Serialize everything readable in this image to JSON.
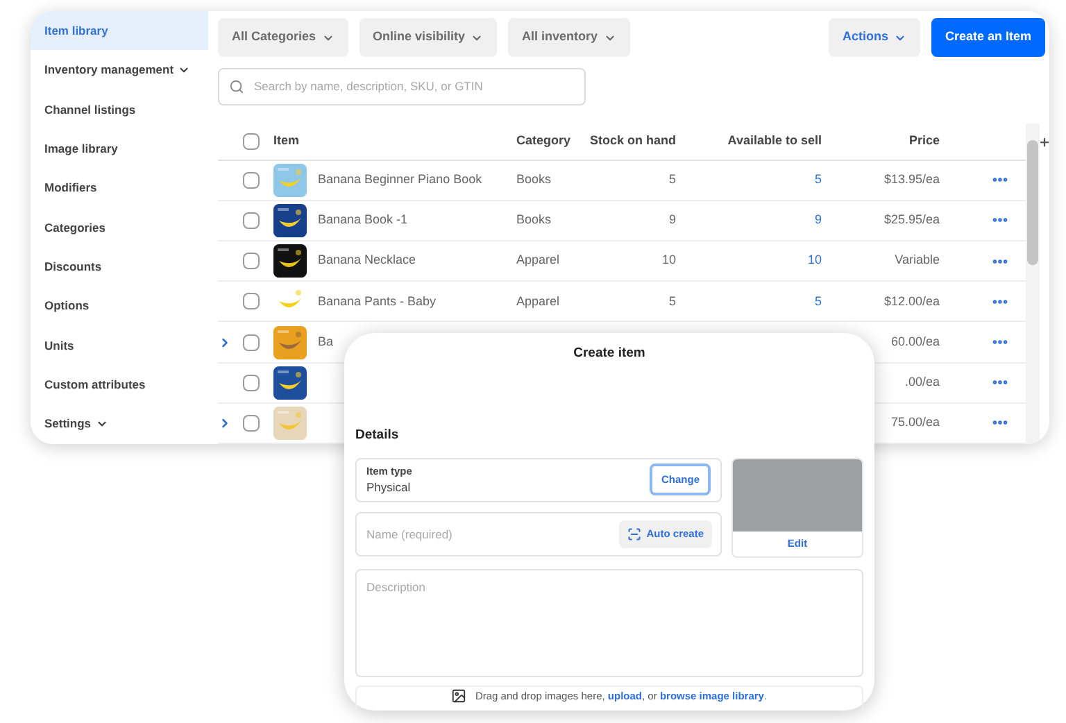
{
  "sidebar": {
    "items": [
      {
        "label": "Item library",
        "selected": true,
        "expandable": false
      },
      {
        "label": "Inventory management",
        "selected": false,
        "expandable": true
      },
      {
        "label": "Channel listings",
        "selected": false,
        "expandable": false
      },
      {
        "label": "Image library",
        "selected": false,
        "expandable": false
      },
      {
        "label": "Modifiers",
        "selected": false,
        "expandable": false
      },
      {
        "label": "Categories",
        "selected": false,
        "expandable": false
      },
      {
        "label": "Discounts",
        "selected": false,
        "expandable": false
      },
      {
        "label": "Options",
        "selected": false,
        "expandable": false
      },
      {
        "label": "Units",
        "selected": false,
        "expandable": false
      },
      {
        "label": "Custom attributes",
        "selected": false,
        "expandable": false
      },
      {
        "label": "Settings",
        "selected": false,
        "expandable": true
      }
    ]
  },
  "toolbar": {
    "filters": [
      {
        "label": "All Categories"
      },
      {
        "label": "Online visibility"
      },
      {
        "label": "All inventory"
      }
    ],
    "actions": {
      "label": "Actions"
    },
    "create_button": {
      "label": "Create an Item"
    }
  },
  "search": {
    "placeholder": "Search by name, description, SKU, or GTIN"
  },
  "table": {
    "columns": [
      "Item",
      "Category",
      "Stock on hand",
      "Available to sell",
      "Price"
    ],
    "select_all": {
      "checked": false
    },
    "rows": [
      {
        "expandable": false,
        "checked": false,
        "name": "Banana Beginner Piano Book",
        "category": "Books",
        "stock": "5",
        "available": "5",
        "price": "$13.95/ea"
      },
      {
        "expandable": false,
        "checked": false,
        "name": "Banana Book -1",
        "category": "Books",
        "stock": "9",
        "available": "9",
        "price": "$25.95/ea"
      },
      {
        "expandable": false,
        "checked": false,
        "name": "Banana Necklace",
        "category": "Apparel",
        "stock": "10",
        "available": "10",
        "price": "Variable"
      },
      {
        "expandable": false,
        "checked": false,
        "name": "Banana Pants - Baby",
        "category": "Apparel",
        "stock": "5",
        "available": "5",
        "price": "$12.00/ea"
      },
      {
        "expandable": true,
        "checked": false,
        "name": "Ba",
        "price": "60.00/ea"
      },
      {
        "expandable": false,
        "checked": false,
        "price": ".00/ea"
      },
      {
        "expandable": true,
        "checked": false,
        "price": "75.00/ea"
      }
    ]
  },
  "dialog": {
    "title": "Create item",
    "section": "Details",
    "item_type": {
      "label": "Item type",
      "value": "Physical",
      "button": "Change"
    },
    "name_field": {
      "placeholder": "Name (required)",
      "button": "Auto create"
    },
    "image": {
      "button": "Edit"
    },
    "description": {
      "placeholder": "Description"
    },
    "dropzone": {
      "text": "Drag and drop images here, ",
      "upload_link": "upload",
      "middle": ", or ",
      "library_link": "browse image library",
      "end": "."
    }
  }
}
